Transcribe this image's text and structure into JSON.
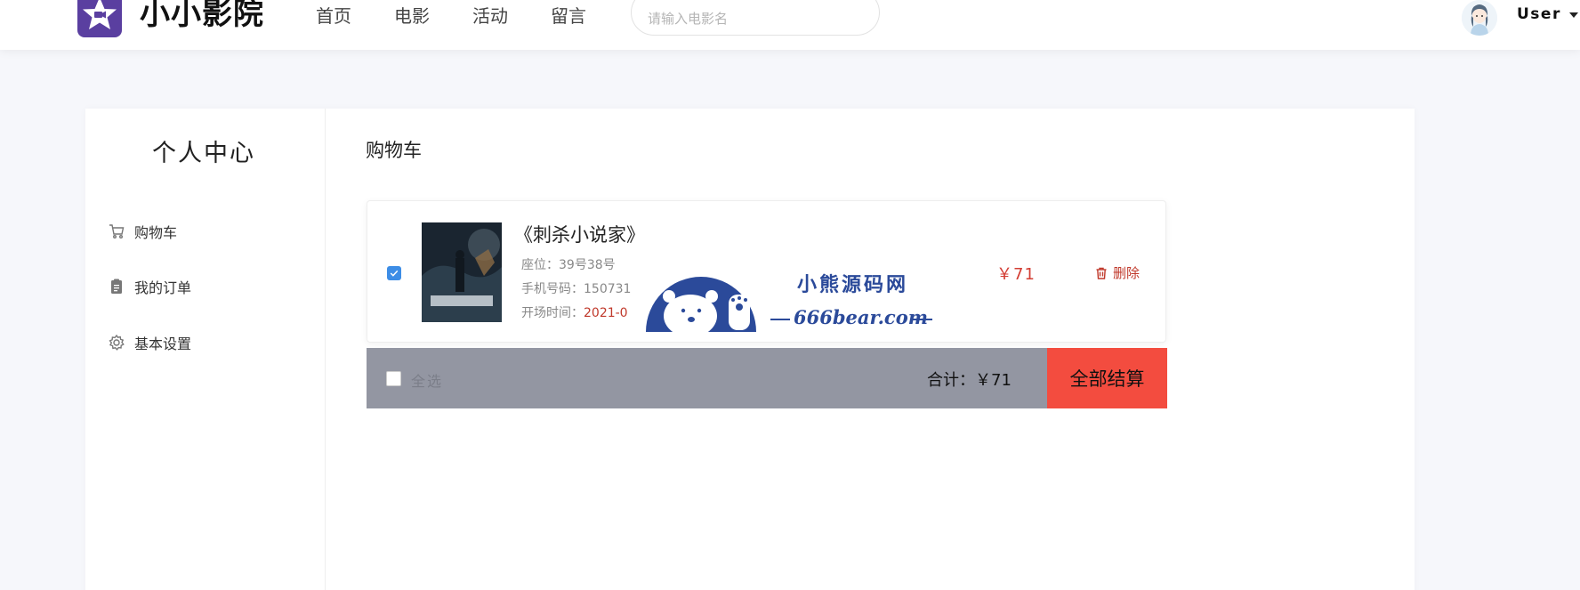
{
  "header": {
    "brand": "小小影院",
    "nav": [
      "首页",
      "电影",
      "活动",
      "留言"
    ],
    "search_placeholder": "请输入电影名",
    "user_name": "User"
  },
  "sidebar": {
    "title": "个人中心",
    "items": [
      {
        "label": "购物车",
        "icon": "cart-icon"
      },
      {
        "label": "我的订单",
        "icon": "clipboard-icon"
      },
      {
        "label": "基本设置",
        "icon": "gear-icon"
      }
    ]
  },
  "main": {
    "title": "购物车",
    "item": {
      "checked": true,
      "title": "《刺杀小说家》",
      "seat": "座位：39号38号",
      "phone": "手机号码：150731",
      "time_label": "开场时间：",
      "time_value": "2021-0",
      "price": "￥71",
      "delete_label": "删除"
    },
    "footer": {
      "select_all": "全选",
      "total": "合计：￥71",
      "checkout": "全部结算"
    }
  },
  "watermark": {
    "line1": "小熊源码网",
    "line2": "666bear.com"
  },
  "colors": {
    "accent_red": "#f34c3f",
    "price_red": "#d33d33",
    "checkbox_blue": "#3d8de6",
    "footer_gray": "#9396a2",
    "watermark_blue": "#2b4a9a"
  }
}
